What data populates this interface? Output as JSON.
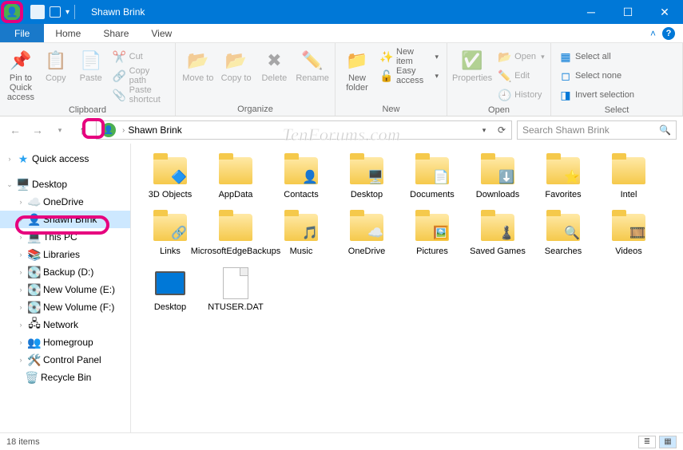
{
  "title": {
    "text": "Shawn Brink"
  },
  "tabs": {
    "file": "File",
    "home": "Home",
    "share": "Share",
    "view": "View"
  },
  "ribbon": {
    "clipboard": {
      "label": "Clipboard",
      "pin": "Pin to Quick access",
      "copy": "Copy",
      "paste": "Paste",
      "cut": "Cut",
      "copypath": "Copy path",
      "shortcut": "Paste shortcut"
    },
    "organize": {
      "label": "Organize",
      "moveto": "Move to",
      "copyto": "Copy to",
      "delete": "Delete",
      "rename": "Rename"
    },
    "new": {
      "label": "New",
      "folder": "New folder",
      "item": "New item",
      "easy": "Easy access"
    },
    "open": {
      "label": "Open",
      "properties": "Properties",
      "open": "Open",
      "edit": "Edit",
      "history": "History"
    },
    "select": {
      "label": "Select",
      "all": "Select all",
      "none": "Select none",
      "invert": "Invert selection"
    }
  },
  "address": {
    "segment": "Shawn Brink"
  },
  "search": {
    "placeholder": "Search Shawn Brink"
  },
  "tree": {
    "quick": "Quick access",
    "desktop": "Desktop",
    "onedrive": "OneDrive",
    "user": "Shawn Brink",
    "thispc": "This PC",
    "libraries": "Libraries",
    "backup": "Backup (D:)",
    "vole": "New Volume (E:)",
    "volf": "New Volume (F:)",
    "network": "Network",
    "homegroup": "Homegroup",
    "cpanel": "Control Panel",
    "recycle": "Recycle Bin"
  },
  "items": [
    {
      "name": "3D Objects"
    },
    {
      "name": "AppData"
    },
    {
      "name": "Contacts"
    },
    {
      "name": "Desktop"
    },
    {
      "name": "Documents"
    },
    {
      "name": "Downloads"
    },
    {
      "name": "Favorites"
    },
    {
      "name": "Intel"
    },
    {
      "name": "Links"
    },
    {
      "name": "MicrosoftEdgeBackups"
    },
    {
      "name": "Music"
    },
    {
      "name": "OneDrive"
    },
    {
      "name": "Pictures"
    },
    {
      "name": "Saved Games"
    },
    {
      "name": "Searches"
    },
    {
      "name": "Videos"
    },
    {
      "name": "Desktop"
    },
    {
      "name": "NTUSER.DAT"
    }
  ],
  "status": {
    "count": "18 items"
  },
  "watermark": "TenForums.com"
}
